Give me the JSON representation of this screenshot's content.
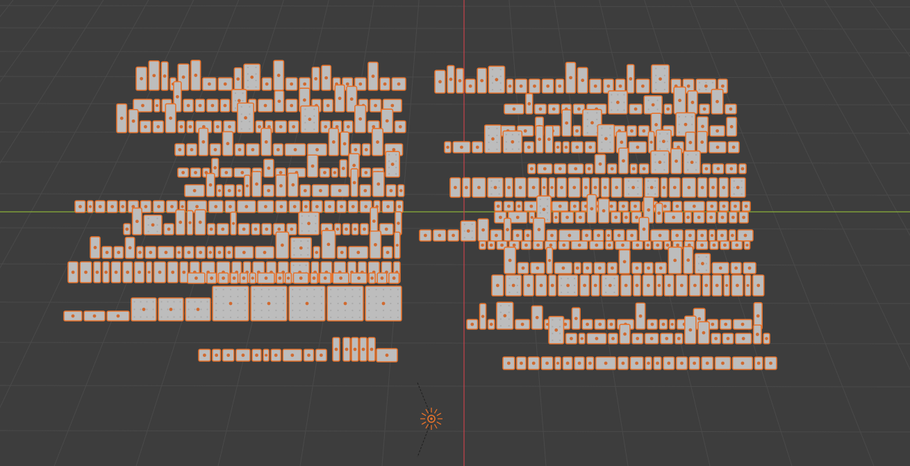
{
  "viewport": {
    "mode": "object",
    "colors": {
      "background": "#3d3d3d",
      "grid_line": "#4a4a4a",
      "axis_x": "#8bb33a",
      "axis_z": "#c8424b",
      "selection_outline": "#e8722a",
      "part_fill": "#bdbdbd",
      "stud_fill": "#d06a30"
    }
  },
  "scene_objects": {
    "left_cluster": {
      "selected": true,
      "kind": "brick-parts",
      "rows": 13
    },
    "right_cluster": {
      "selected": true,
      "kind": "brick-parts",
      "rows": 15
    },
    "light": {
      "icon": "sun-light-icon",
      "selected": true
    }
  }
}
